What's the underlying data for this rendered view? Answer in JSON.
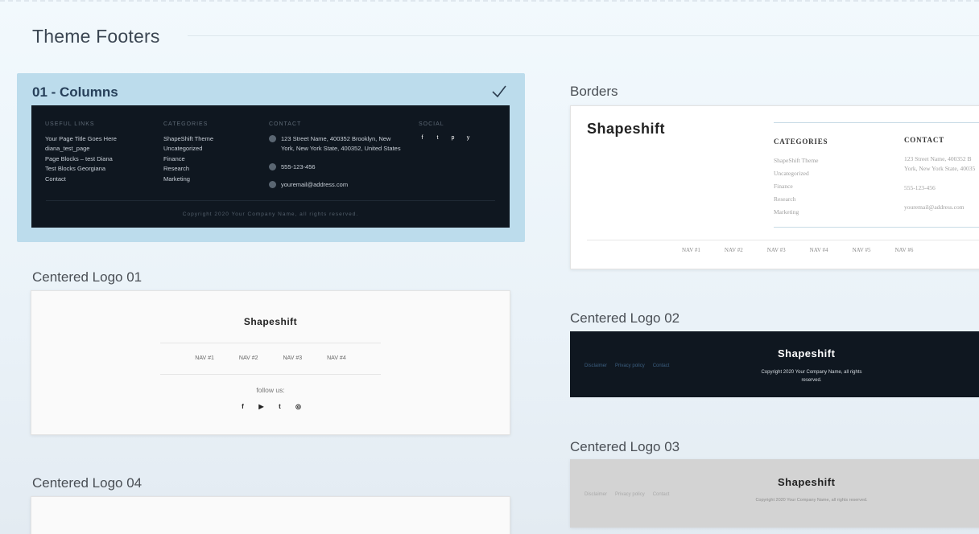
{
  "page": {
    "title": "Theme Footers"
  },
  "columns_card": {
    "label": "01 - Columns",
    "useful_links": {
      "heading": "USEFUL LINKS",
      "items": [
        "Your Page Title Goes Here",
        "diana_test_page",
        "Page Blocks – test Diana",
        "Test Blocks Georgiana",
        "Contact"
      ]
    },
    "categories": {
      "heading": "CATEGORIES",
      "items": [
        "ShapeShift Theme",
        "Uncategorized",
        "Finance",
        "Research",
        "Marketing"
      ]
    },
    "contact": {
      "heading": "CONTACT",
      "address": "123 Street Name, 400352 Brooklyn, New York, New York State, 400352, United States",
      "phone": "555-123-456",
      "email": "youremail@address.com"
    },
    "social": {
      "heading": "SOCIAL",
      "icons": [
        "f",
        "t",
        "p",
        "y"
      ]
    },
    "copyright": "Copyright 2020 Your Company Name, all rights reserved."
  },
  "borders_card": {
    "label": "Borders",
    "brand": "Shapeshift",
    "categories": {
      "heading": "CATEGORIES",
      "items": [
        "ShapeShift Theme",
        "Uncategorized",
        "Finance",
        "Research",
        "Marketing"
      ]
    },
    "contact": {
      "heading": "CONTACT",
      "address": "123 Street Name, 400352 B",
      "address2": "York, New York State, 40035",
      "phone": "555-123-456",
      "email": "youremail@address.com"
    },
    "nav": [
      "NAV #1",
      "NAV #2",
      "NAV #3",
      "NAV #4",
      "NAV #5",
      "NAV #6"
    ]
  },
  "centered_logo_01": {
    "label": "Centered Logo 01",
    "brand": "Shapeshift",
    "nav": [
      "NAV #1",
      "NAV #2",
      "NAV #3",
      "NAV #4"
    ],
    "follow": "follow us:",
    "social": [
      "f",
      "▶",
      "t",
      "◎"
    ]
  },
  "centered_logo_02": {
    "label": "Centered Logo 02",
    "brand": "Shapeshift",
    "links": [
      "Disclaimer",
      "Privacy policy",
      "Contact"
    ],
    "copyright": "Copyright 2020 Your Company Name, all rights reserved."
  },
  "centered_logo_03": {
    "label": "Centered Logo 03",
    "brand": "Shapeshift",
    "links": [
      "Disclaimer",
      "Privacy policy",
      "Contact"
    ],
    "copyright": "Copyright 2020 Your Company Name, all rights reserved."
  },
  "centered_logo_04": {
    "label": "Centered Logo 04"
  }
}
